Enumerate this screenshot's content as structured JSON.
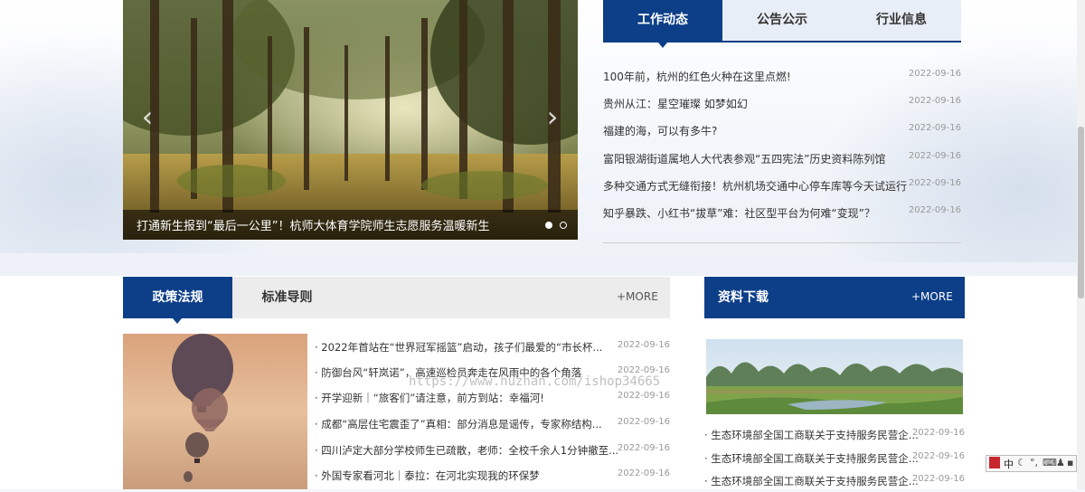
{
  "slider": {
    "caption": "打通新生报到“最后一公里”！杭师大体育学院师生志愿服务温暖新生",
    "prev_icon": "‹",
    "next_icon": "›"
  },
  "news": {
    "tabs": [
      {
        "label": "工作动态"
      },
      {
        "label": "公告公示"
      },
      {
        "label": "行业信息"
      }
    ],
    "items": [
      {
        "title": "100年前，杭州的红色火种在这里点燃!",
        "date": "2022-09-16"
      },
      {
        "title": "贵州从江：星空璀璨 如梦如幻",
        "date": "2022-09-16"
      },
      {
        "title": "福建的海，可以有多牛?",
        "date": "2022-09-16"
      },
      {
        "title": "富阳银湖街道属地人大代表参观“五四宪法”历史资料陈列馆",
        "date": "2022-09-16"
      },
      {
        "title": "多种交通方式无缝衔接！杭州机场交通中心停车库等今天试运行",
        "date": "2022-09-16"
      },
      {
        "title": "知乎暴跌、小红书“拔草”难：社区型平台为何难“变现”？",
        "date": "2022-09-16"
      }
    ]
  },
  "policy": {
    "tabs": [
      {
        "label": "政策法规"
      },
      {
        "label": "标准导则"
      }
    ],
    "more": "+MORE",
    "items": [
      {
        "title": "· 2022年首站在“世界冠军摇篮”启动，孩子们最爱的“市长杯...",
        "date": "2022-09-16"
      },
      {
        "title": "· 防御台风“轩岚诺”，高速巡检员奔走在风雨中的各个角落",
        "date": "2022-09-16"
      },
      {
        "title": "· 开学迎新｜“旅客们”请注意，前方到站：幸福河!",
        "date": "2022-09-16"
      },
      {
        "title": "· 成都“高层住宅震歪了”真相：部分消息是谣传，专家称结构...",
        "date": "2022-09-16"
      },
      {
        "title": "· 四川泸定大部分学校师生已疏散，老师：全校千余人1分钟撤至...",
        "date": "2022-09-16"
      },
      {
        "title": "· 外国专家看河北｜泰拉：在河北实现我的环保梦",
        "date": "2022-09-16"
      }
    ]
  },
  "downloads": {
    "title": "资料下载",
    "more": "+MORE",
    "items": [
      {
        "title": "· 生态环境部全国工商联关于支持服务民营企...",
        "date": "2022-09-16"
      },
      {
        "title": "· 生态环境部全国工商联关于支持服务民营企...",
        "date": "2022-09-16"
      },
      {
        "title": "· 生态环境部全国工商联关于支持服务民营企...",
        "date": "2022-09-16"
      }
    ]
  },
  "watermark": "https://www.huzhan.com/ishop34665",
  "ime": {
    "mode": "中",
    "icons": [
      "ime-logo-icon",
      "moon-icon",
      "punct-icon",
      "keyboard-icon",
      "user-icon",
      "tool-icon"
    ]
  },
  "colors": {
    "brand": "#0d3f88",
    "tab_bg": "#e8eef7",
    "date": "#999999"
  }
}
